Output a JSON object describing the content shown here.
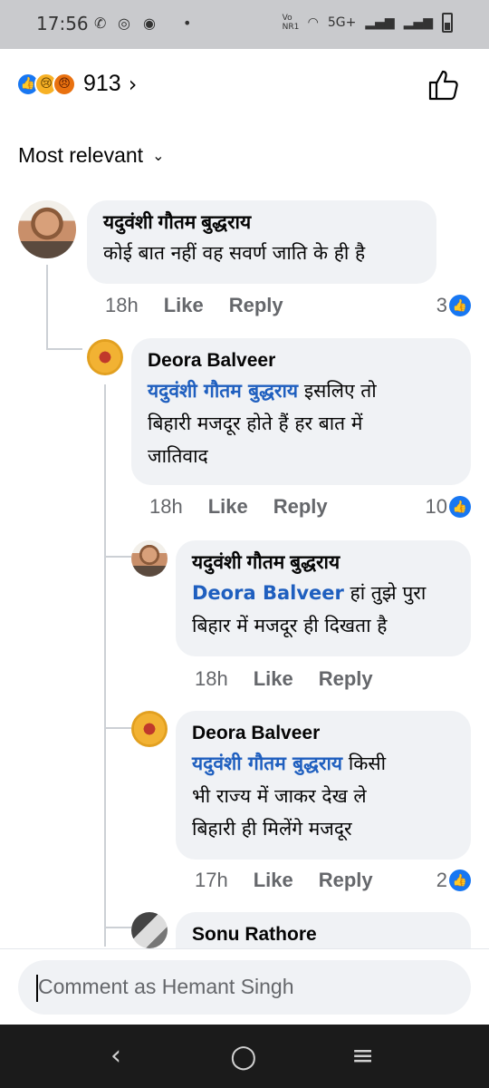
{
  "status_bar": {
    "time": "17:56",
    "network": "5G+",
    "carrier": "Vo NR1"
  },
  "reactions": {
    "count": "913",
    "icons": [
      "like-icon",
      "sad-icon",
      "angry-icon"
    ]
  },
  "sort": {
    "label": "Most relevant"
  },
  "comments": [
    {
      "author": "यदुवंशी गौतम बुद्धराय",
      "text": "कोई बात नहीं वह सवर्ण जाति के ही है",
      "time": "18h",
      "like": "Like",
      "reply": "Reply",
      "likes": "3"
    },
    {
      "author": "Deora Balveer",
      "mention": "यदुवंशी गौतम बुद्धराय",
      "text_line1": "इसलिए तो",
      "text_line2": "बिहारी मजदूर होते हैं हर बात में",
      "text_line3": "जातिवाद",
      "time": "18h",
      "like": "Like",
      "reply": "Reply",
      "likes": "10"
    },
    {
      "author": "यदुवंशी गौतम बुद्धराय",
      "mention": "Deora Balveer",
      "text_line1": "हां तुझे पुरा",
      "text_line2": "बिहार में मजदूर ही दिखता है",
      "time": "18h",
      "like": "Like",
      "reply": "Reply"
    },
    {
      "author": "Deora Balveer",
      "mention": "यदुवंशी गौतम बुद्धराय",
      "text_line1": "किसी",
      "text_line2": "भी राज्य में जाकर देख ले",
      "text_line3": "बिहारी ही मिलेंगे मजदूर",
      "time": "17h",
      "like": "Like",
      "reply": "Reply",
      "likes": "2"
    },
    {
      "author": "Sonu Rathore"
    }
  ],
  "composer": {
    "placeholder": "Comment as Hemant Singh"
  },
  "colors": {
    "accent": "#1877f2",
    "mention": "#1f5fbf",
    "bubble": "#f0f2f5"
  }
}
